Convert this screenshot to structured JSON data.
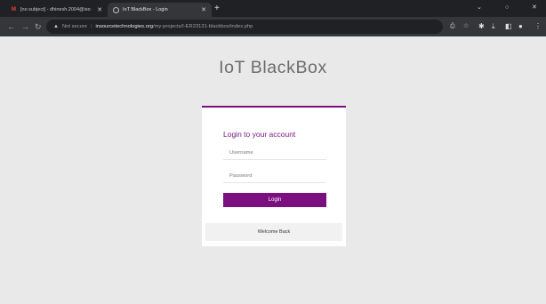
{
  "browser": {
    "tabs": [
      {
        "title": "[no subject] - dhinesh.2004@iso",
        "active": false
      },
      {
        "title": "IoT BlackBox - Login",
        "active": true
      }
    ],
    "new_tab": "+",
    "window_controls": {
      "minimize": "⌄",
      "restore": "○",
      "close": "✕"
    },
    "address": {
      "security_label": "Not secure",
      "host": "insourcetechnologies.org",
      "path": "/my-projects/I-ER23131-blackbox/index.php"
    }
  },
  "page": {
    "brand_title": "IoT BlackBox",
    "login": {
      "heading": "Login to your account",
      "username_placeholder": "Username",
      "password_placeholder": "Password",
      "button_label": "Login",
      "footer_text": "Welcome Back"
    }
  },
  "colors": {
    "accent": "#7b0f80",
    "page_bg": "#e9e9e9"
  }
}
